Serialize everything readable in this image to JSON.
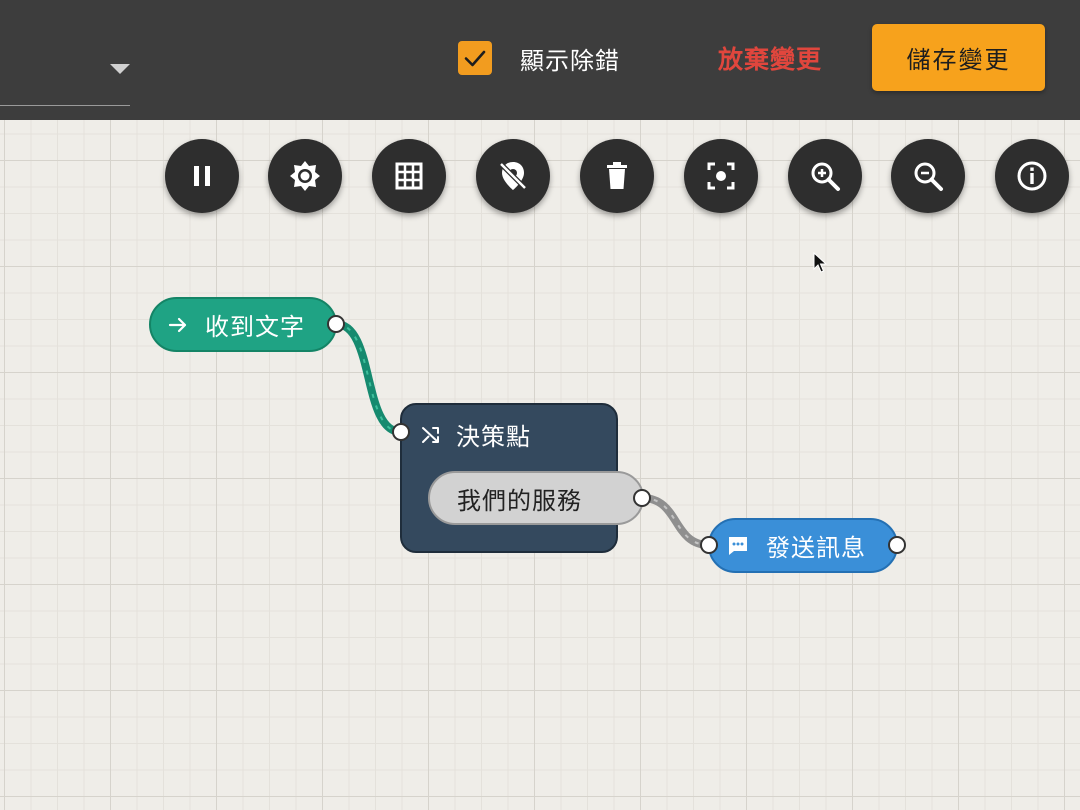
{
  "header": {
    "debug_label": "顯示除錯",
    "debug_checked": true,
    "discard_label": "放棄變更",
    "save_label": "儲存變更"
  },
  "toolbar": [
    {
      "name": "pause-button",
      "icon": "pause-icon"
    },
    {
      "name": "settings-button",
      "icon": "gear-icon"
    },
    {
      "name": "grid-button",
      "icon": "grid-icon"
    },
    {
      "name": "hide-location-button",
      "icon": "location-off-icon"
    },
    {
      "name": "delete-button",
      "icon": "trash-icon"
    },
    {
      "name": "center-focus-button",
      "icon": "center-focus-icon"
    },
    {
      "name": "zoom-in-button",
      "icon": "zoom-in-icon"
    },
    {
      "name": "zoom-out-button",
      "icon": "zoom-out-icon"
    },
    {
      "name": "info-button",
      "icon": "info-icon"
    }
  ],
  "nodes": {
    "trigger": {
      "label": "收到文字",
      "icon": "arrow-right-icon"
    },
    "decision": {
      "title": "決策點",
      "icon": "shuffle-icon",
      "option": "我們的服務"
    },
    "send": {
      "label": "發送訊息",
      "icon": "chat-icon"
    }
  },
  "colors": {
    "topbar": "#3d3d3d",
    "accent_orange": "#f7a21c",
    "discard_red": "#e0463d",
    "trigger_green": "#1fa384",
    "decision_navy": "#34495e",
    "send_blue": "#3a8fd8"
  }
}
